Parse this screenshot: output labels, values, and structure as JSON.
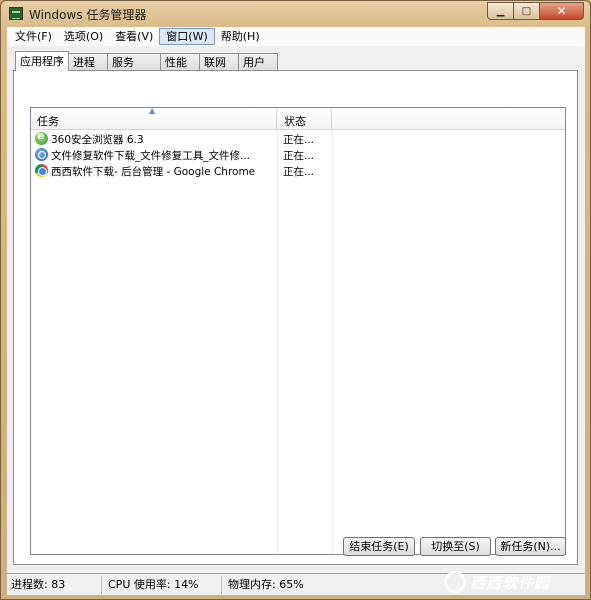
{
  "window": {
    "title": "Windows 任务管理器",
    "min_glyph": "▁",
    "max_glyph": "□",
    "close_glyph": "✕"
  },
  "menu": [
    {
      "label": "文件(F)",
      "active": false
    },
    {
      "label": "选项(O)",
      "active": false
    },
    {
      "label": "查看(V)",
      "active": false
    },
    {
      "label": "窗口(W)",
      "active": true
    },
    {
      "label": "帮助(H)",
      "active": false
    }
  ],
  "tabs": [
    {
      "label": "应用程序",
      "active": true
    },
    {
      "label": "进程",
      "active": false
    },
    {
      "label": "服务",
      "active": false
    },
    {
      "label": "性能",
      "active": false
    },
    {
      "label": "联网",
      "active": false
    },
    {
      "label": "用户",
      "active": false
    }
  ],
  "list": {
    "columns": {
      "task": "任务",
      "status": "状态"
    },
    "sort_indicator": "▲",
    "rows": [
      {
        "icon": "360-browser-icon",
        "task": "360安全浏览器 6.3",
        "status": "正在..."
      },
      {
        "icon": "file-repair-icon",
        "task": "文件修复软件下载_文件修复工具_文件修...",
        "status": "正在..."
      },
      {
        "icon": "chrome-icon",
        "task": "西西软件下载- 后台管理 - Google Chrome",
        "status": "正在..."
      }
    ]
  },
  "buttons": {
    "end_task": "结束任务(E)",
    "switch_to": "切换至(S)",
    "new_task": "新任务(N)..."
  },
  "statusbar": {
    "processes": "进程数: 83",
    "cpu": "CPU 使用率: 14%",
    "memory": "物理内存: 65%"
  },
  "watermark": {
    "text": "西西软件园"
  }
}
